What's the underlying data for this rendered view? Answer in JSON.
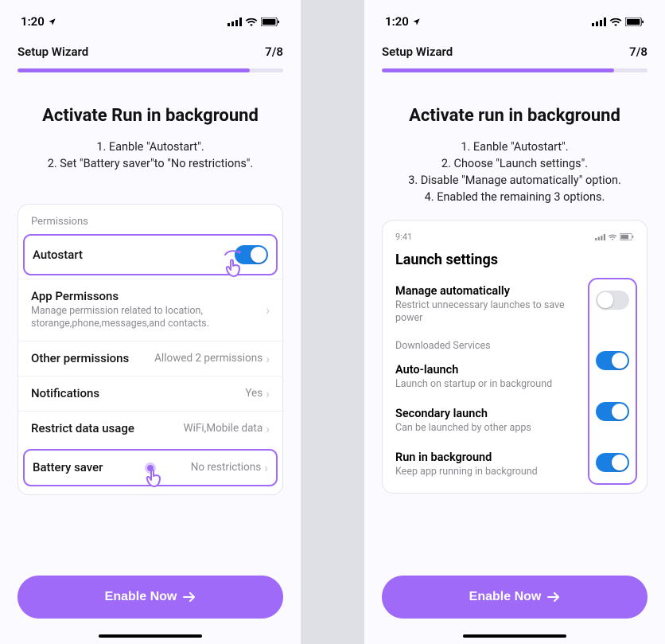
{
  "status_time": "1:20",
  "wizard": {
    "label": "Setup Wizard",
    "progress": "7/8"
  },
  "cta_label": "Enable Now",
  "left": {
    "title": "Activate Run in background",
    "instructions": [
      "Eanble \"Autostart\".",
      "Set \"Battery saver\"to \"No restrictions\"."
    ],
    "permissions_header": "Permissions",
    "autostart": {
      "label": "Autostart"
    },
    "app_permissions": {
      "label": "App Permissons",
      "desc": "Manage permission related to location, storange,phone,messages,and contacts."
    },
    "other_permissions": {
      "label": "Other permissions",
      "value": "Allowed 2 permissions"
    },
    "notifications": {
      "label": "Notifications",
      "value": "Yes"
    },
    "restrict_data": {
      "label": "Restrict data usage",
      "value": "WiFi,Mobile data"
    },
    "battery_saver": {
      "label": "Battery saver",
      "value": "No restrictions"
    }
  },
  "right": {
    "title": "Activate run in background",
    "instructions": [
      "Eanble \"Autostart\".",
      "Choose \"Launch settings\".",
      "Disable \"Manage automatically\" option.",
      "Enabled the remaining 3 options."
    ],
    "inner_time": "9:41",
    "launch_title": "Launch settings",
    "manage": {
      "name": "Manage automatically",
      "desc": "Restrict unnecessary launches to save power"
    },
    "downloaded_header": "Downloaded Services",
    "auto_launch": {
      "name": "Auto-launch",
      "desc": "Launch on startup or in background"
    },
    "secondary_launch": {
      "name": "Secondary launch",
      "desc": "Can be launched by other apps"
    },
    "run_bg": {
      "name": "Run in background",
      "desc": "Keep app running in background"
    }
  }
}
